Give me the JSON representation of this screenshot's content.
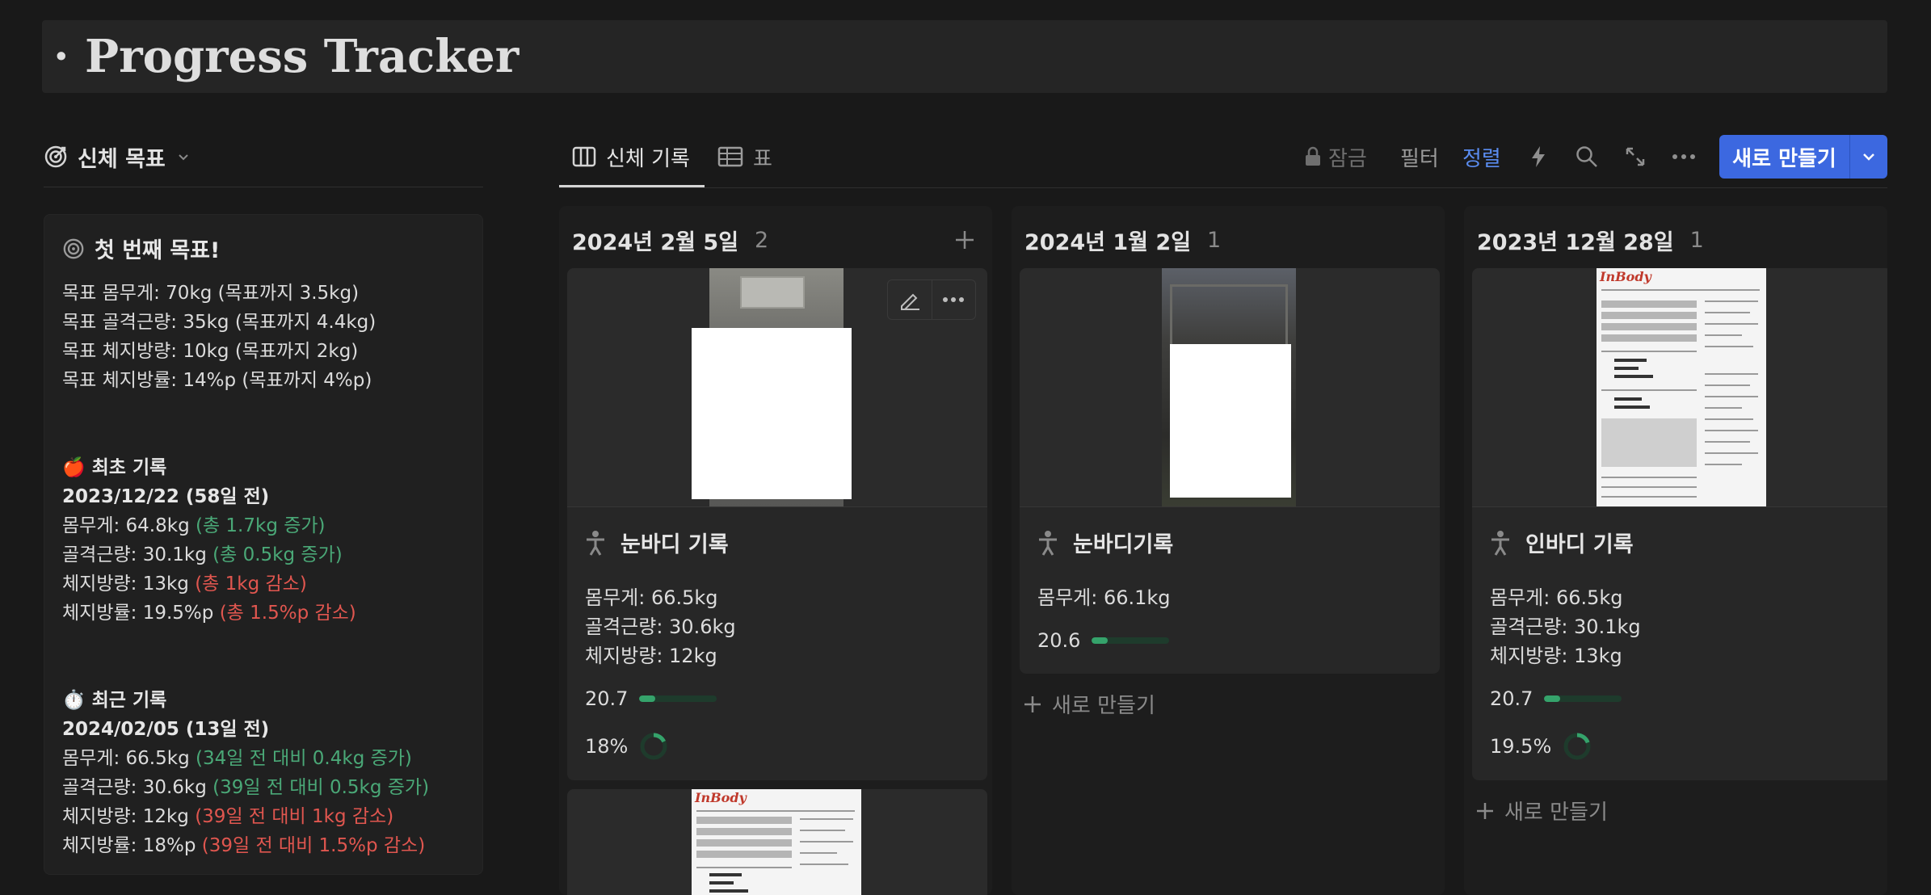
{
  "page": {
    "title": "· Progress Tracker"
  },
  "goal_section": {
    "header_label": "신체 목표",
    "card": {
      "heading": "첫 번째 목표!",
      "targets": [
        "목표 몸무게: 70kg (목표까지 3.5kg)",
        "목표 골격근량: 35kg (목표까지 4.4kg)",
        "목표 체지방량: 10kg (목표까지 2kg)",
        "목표 체지방률: 14%p (목표까지 4%p)"
      ],
      "first_record": {
        "label": "🍎 최초 기록",
        "date": "2023/12/22 (58일 전)",
        "lines": [
          {
            "main": "몸무게: 64.8kg",
            "delta": "(총 1.7kg 증가)",
            "tone": "green"
          },
          {
            "main": "골격근량: 30.1kg",
            "delta": "(총 0.5kg 증가)",
            "tone": "green"
          },
          {
            "main": "체지방량: 13kg",
            "delta": "(총 1kg 감소)",
            "tone": "red"
          },
          {
            "main": "체지방률: 19.5%p",
            "delta": "(총 1.5%p 감소)",
            "tone": "red"
          }
        ]
      },
      "recent_record": {
        "label": "⏱️ 최근 기록",
        "date": "2024/02/05 (13일 전)",
        "lines": [
          {
            "main": "몸무게: 66.5kg",
            "delta": "(34일 전 대비 0.4kg 증가)",
            "tone": "green"
          },
          {
            "main": "골격근량: 30.6kg",
            "delta": "(39일 전 대비 0.5kg 증가)",
            "tone": "green"
          },
          {
            "main": "체지방량: 12kg",
            "delta": "(39일 전 대비 1kg 감소)",
            "tone": "red"
          },
          {
            "main": "체지방률: 18%p",
            "delta": "(39일 전 대비 1.5%p 감소)",
            "tone": "red"
          }
        ]
      }
    }
  },
  "view_tabs": [
    {
      "label": "신체 기록",
      "icon": "board-icon",
      "active": true
    },
    {
      "label": "표",
      "icon": "table-icon",
      "active": false
    }
  ],
  "toolbar": {
    "lock_label": "잠금",
    "filter_label": "필터",
    "sort_label": "정렬",
    "new_label": "새로 만들기",
    "icons": [
      "lightning-icon",
      "search-icon",
      "expand-icon",
      "more-icon"
    ]
  },
  "colors": {
    "accent": "#3c68e0",
    "sort_active": "#5a8cf0",
    "positive": "#4aa877",
    "negative": "#e0564f",
    "progress": "#35a36b"
  },
  "columns": [
    {
      "date": "2024년 2월 5일",
      "count": "2",
      "cards": [
        {
          "title": "눈바디 기록",
          "props": [
            "몸무게: 66.5kg",
            "골격근량: 30.6kg",
            "체지방량: 12kg"
          ],
          "bar_label": "20.7",
          "bar_fraction": 0.207,
          "ring_label": "18%",
          "ring_fraction": 0.18
        }
      ]
    },
    {
      "date": "2024년 1월 2일",
      "count": "1",
      "new_card_label": "새로 만들기",
      "cards": [
        {
          "title": "눈바디기록",
          "props": [
            "몸무게: 66.1kg"
          ],
          "bar_label": "20.6",
          "bar_fraction": 0.206
        }
      ]
    },
    {
      "date": "2023년 12월 28일",
      "count": "1",
      "new_card_label": "새로 만들기",
      "cards": [
        {
          "title": "인바디 기록",
          "props": [
            "몸무게: 66.5kg",
            "골격근량: 30.1kg",
            "체지방량: 13kg"
          ],
          "bar_label": "20.7",
          "bar_fraction": 0.207,
          "ring_label": "19.5%",
          "ring_fraction": 0.195,
          "cover_logo": "InBody"
        }
      ]
    }
  ]
}
